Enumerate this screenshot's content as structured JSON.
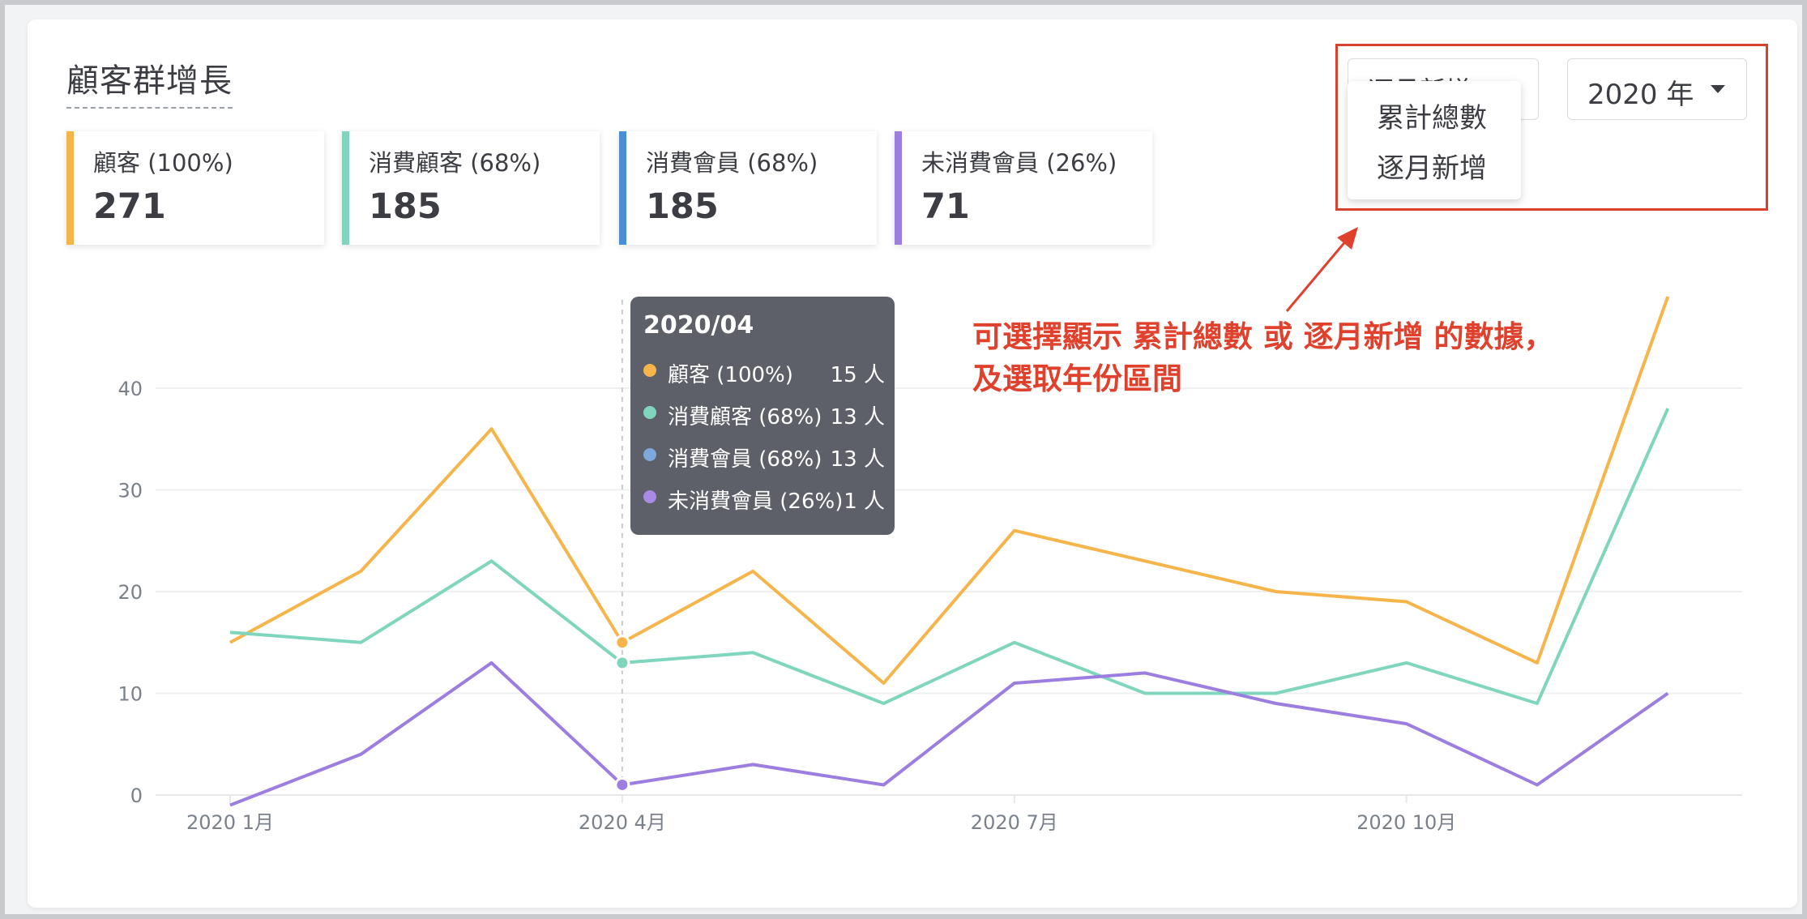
{
  "page_title": "顧客群增長",
  "kpis": [
    {
      "label": "顧客 (100%)",
      "value": "271",
      "color": "#f5b54b"
    },
    {
      "label": "消費顧客 (68%)",
      "value": "185",
      "color": "#7fd6bd"
    },
    {
      "label": "消費會員 (68%)",
      "value": "185",
      "color": "#4a8fd6"
    },
    {
      "label": "未消費會員 (26%)",
      "value": "71",
      "color": "#9b7ee0"
    }
  ],
  "controls": {
    "mode_select_value": "逐月新增",
    "mode_options": [
      "累計總數",
      "逐月新增"
    ],
    "year_select_value": "2020 年"
  },
  "annotation": {
    "line1": "可選擇顯示 累計總數 或 逐月新增 的數據，",
    "line2": "及選取年份區間"
  },
  "tooltip": {
    "title": "2020/04",
    "rows": [
      {
        "name": "顧客 (100%)",
        "value": "15 人",
        "color": "#f5b54b"
      },
      {
        "name": "消費顧客 (68%)",
        "value": "13 人",
        "color": "#7fd6bd"
      },
      {
        "name": "消費會員 (68%)",
        "value": "13 人",
        "color": "#7fa8dc"
      },
      {
        "name": "未消費會員 (26%)",
        "value": "1 人",
        "color": "#a98be6"
      }
    ]
  },
  "chart_data": {
    "type": "line",
    "x": [
      "2020/01",
      "2020/02",
      "2020/03",
      "2020/04",
      "2020/05",
      "2020/06",
      "2020/07",
      "2020/08",
      "2020/09",
      "2020/10",
      "2020/11",
      "2020/12"
    ],
    "x_tick_labels": [
      {
        "index": 0,
        "label": "2020 1月"
      },
      {
        "index": 3,
        "label": "2020 4月"
      },
      {
        "index": 6,
        "label": "2020 7月"
      },
      {
        "index": 9,
        "label": "2020 10月"
      }
    ],
    "y_ticks": [
      0,
      10,
      20,
      30,
      40
    ],
    "ylim": [
      0,
      40
    ],
    "grid": true,
    "highlight_index": 3,
    "series": [
      {
        "name": "顧客 (100%)",
        "color": "#f5b54b",
        "values": [
          15,
          22,
          36,
          15,
          22,
          11,
          26,
          23,
          20,
          19,
          13,
          49
        ]
      },
      {
        "name": "消費顧客 (68%)",
        "color": "#7fd6bd",
        "values": [
          16,
          15,
          23,
          13,
          14,
          9,
          15,
          10,
          10,
          13,
          9,
          38
        ]
      },
      {
        "name": "未消費會員 (26%)",
        "color": "#9b7ee0",
        "values": [
          -1,
          4,
          13,
          1,
          3,
          1,
          11,
          12,
          9,
          7,
          1,
          10
        ]
      }
    ]
  }
}
